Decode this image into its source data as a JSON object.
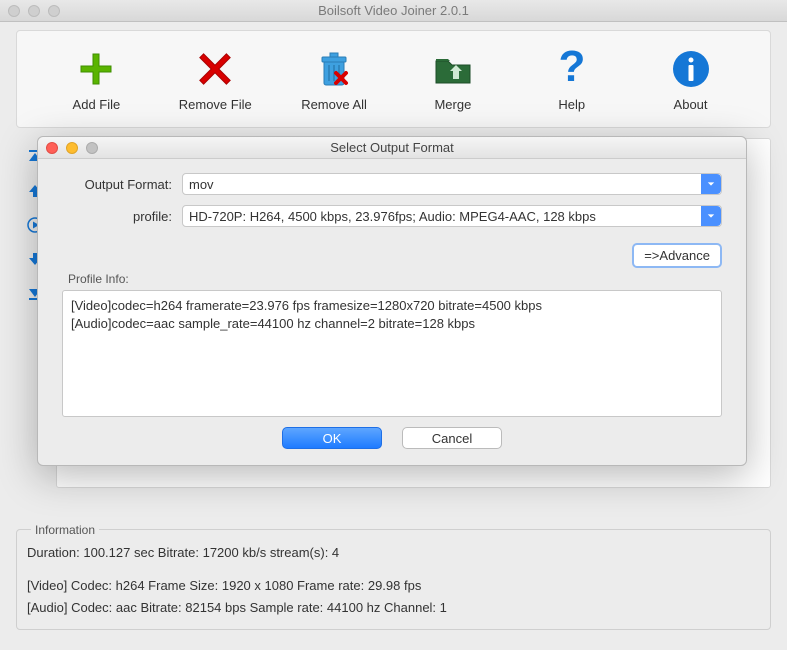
{
  "app": {
    "title": "Boilsoft Video Joiner 2.0.1"
  },
  "toolbar": {
    "add_file": "Add File",
    "remove_file": "Remove File",
    "remove_all": "Remove All",
    "merge": "Merge",
    "help": "Help",
    "about": "About"
  },
  "modal": {
    "title": "Select Output Format",
    "output_format_label": "Output Format:",
    "output_format_value": "mov",
    "profile_label": "profile:",
    "profile_value": "HD-720P: H264, 4500 kbps, 23.976fps;  Audio: MPEG4-AAC, 128 kbps",
    "advance_button": "=>Advance",
    "profile_info_label": "Profile Info:",
    "profile_info_text": "[Video]codec=h264 framerate=23.976 fps framesize=1280x720 bitrate=4500 kbps\n[Audio]codec=aac sample_rate=44100 hz channel=2 bitrate=128 kbps",
    "ok": "OK",
    "cancel": "Cancel"
  },
  "info": {
    "legend": "Information",
    "line1": "Duration: 100.127 sec  Bitrate: 17200 kb/s  stream(s): 4",
    "line2": "[Video]  Codec: h264  Frame Size: 1920 x 1080  Frame rate: 29.98 fps",
    "line3": "[Audio]  Codec: aac  Bitrate: 82154 bps  Sample rate: 44100 hz  Channel: 1"
  }
}
